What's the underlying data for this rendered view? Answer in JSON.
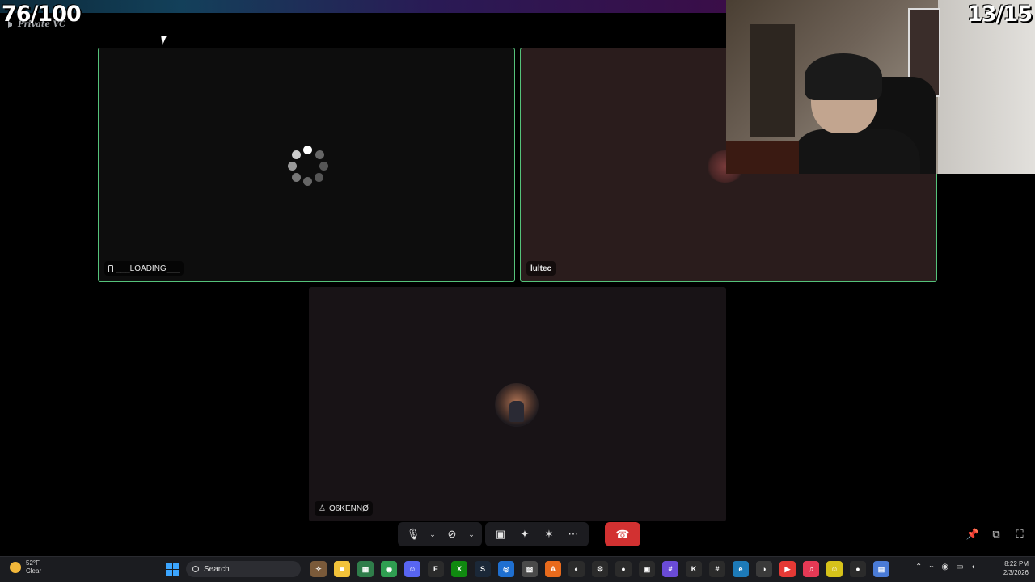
{
  "overlay": {
    "score_left": "76/100",
    "score_right": "13/15",
    "channel_name": "Private VC"
  },
  "tiles": [
    {
      "username": "___LOADING___",
      "speaking": true,
      "status": "loading"
    },
    {
      "username": "lultec",
      "speaking": true
    },
    {
      "username": "O6KENNØ",
      "speaking": false
    }
  ],
  "controls": {
    "mic_icon": "🎙",
    "camera_off_icon": "⊘",
    "share_icon": "▣",
    "activities_icon": "✦",
    "soundboard_icon": "✶",
    "more_icon": "⋯",
    "chevron": "⌄",
    "leave_icon": "☎",
    "pin_icon": "📌",
    "popout_icon": "⧉",
    "fullscreen_icon": "⛶"
  },
  "taskbar": {
    "weather_temp": "52°F",
    "weather_desc": "Clear",
    "search_placeholder": "Search",
    "apps": [
      {
        "name": "sticker",
        "color": "#7a5a3a",
        "glyph": "✧"
      },
      {
        "name": "file-explorer",
        "color": "#f2c23a",
        "glyph": "■"
      },
      {
        "name": "calculator",
        "color": "#2f7d4a",
        "glyph": "▦"
      },
      {
        "name": "chrome",
        "color": "#2f9e51",
        "glyph": "◉"
      },
      {
        "name": "discord",
        "color": "#5865f2",
        "glyph": "☺"
      },
      {
        "name": "epic-games",
        "color": "#2b2b2b",
        "glyph": "E"
      },
      {
        "name": "xbox",
        "color": "#108a10",
        "glyph": "X"
      },
      {
        "name": "steam",
        "color": "#1b2838",
        "glyph": "S"
      },
      {
        "name": "browser",
        "color": "#1f6fd0",
        "glyph": "◎"
      },
      {
        "name": "minecraft",
        "color": "#4a4a4a",
        "glyph": "▧"
      },
      {
        "name": "adobe",
        "color": "#e86a1c",
        "glyph": "A"
      },
      {
        "name": "obs",
        "color": "#2b2b2b",
        "glyph": "◐"
      },
      {
        "name": "steelseries",
        "color": "#2b2b2b",
        "glyph": "⚙"
      },
      {
        "name": "github",
        "color": "#2b2b2b",
        "glyph": "●"
      },
      {
        "name": "roblox",
        "color": "#2b2b2b",
        "glyph": "▣"
      },
      {
        "name": "grid-app",
        "color": "#6a4bd6",
        "glyph": "#"
      },
      {
        "name": "capcut",
        "color": "#2b2b2b",
        "glyph": "K"
      },
      {
        "name": "hashtag-app",
        "color": "#2b2b2b",
        "glyph": "#"
      },
      {
        "name": "edge",
        "color": "#1d7ab8",
        "glyph": "e"
      },
      {
        "name": "media-app",
        "color": "#3a3a3a",
        "glyph": "◑"
      },
      {
        "name": "youtube-app",
        "color": "#e53935",
        "glyph": "▶"
      },
      {
        "name": "music",
        "color": "#e53955",
        "glyph": "♫"
      },
      {
        "name": "emoji-app",
        "color": "#d6c21a",
        "glyph": "☺"
      },
      {
        "name": "maps",
        "color": "#2b2b2b",
        "glyph": "●"
      },
      {
        "name": "notepad",
        "color": "#4a7bd6",
        "glyph": "▤"
      }
    ],
    "time": "8:22 PM",
    "date": "2/3/2026"
  }
}
